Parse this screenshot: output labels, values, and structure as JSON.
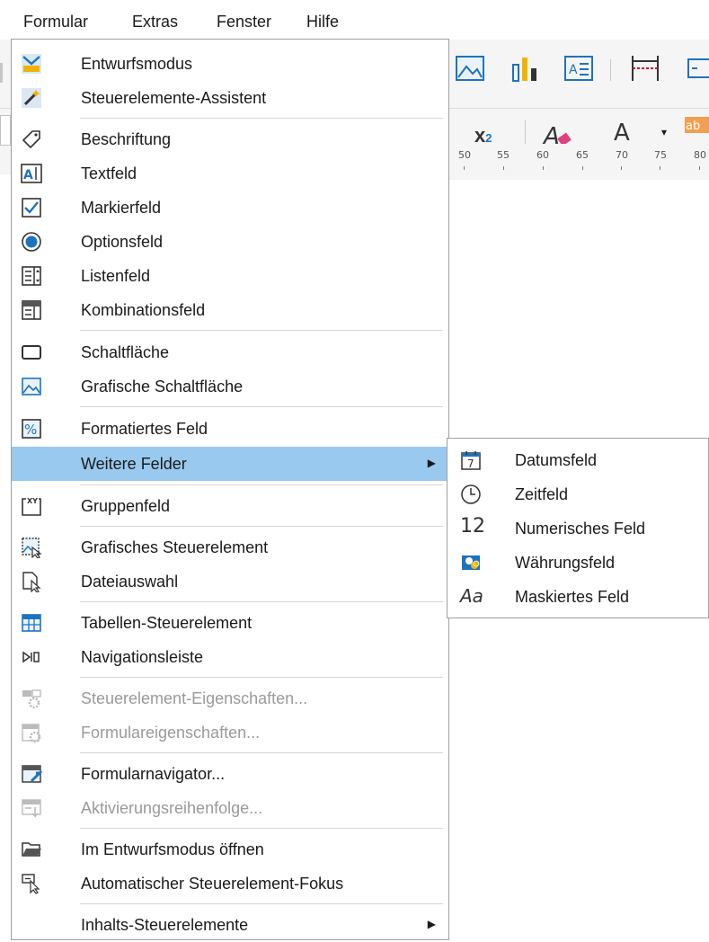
{
  "menubar": {
    "items": [
      "Formular",
      "Extras",
      "Fenster",
      "Hilfe"
    ]
  },
  "ruler": {
    "ticks": [
      "50",
      "55",
      "60",
      "65",
      "70",
      "75",
      "80"
    ]
  },
  "menu": {
    "items": [
      {
        "label": "Entwurfsmodus",
        "icon": "design-mode-icon"
      },
      {
        "label": "Steuerelemente-Assistent",
        "icon": "wizard-icon"
      },
      {
        "label": "Beschriftung",
        "icon": "label-tag-icon"
      },
      {
        "label": "Textfeld",
        "icon": "textbox-icon"
      },
      {
        "label": "Markierfeld",
        "icon": "checkbox-icon"
      },
      {
        "label": "Optionsfeld",
        "icon": "radio-icon"
      },
      {
        "label": "Listenfeld",
        "icon": "listbox-icon"
      },
      {
        "label": "Kombinationsfeld",
        "icon": "combobox-icon"
      },
      {
        "label": "Schaltfläche",
        "icon": "push-button-icon"
      },
      {
        "label": "Grafische Schaltfläche",
        "icon": "image-button-icon"
      },
      {
        "label": "Formatiertes Feld",
        "icon": "formatted-field-icon"
      },
      {
        "label": "Weitere Felder",
        "icon": "",
        "submenu": true,
        "highlighted": true
      },
      {
        "label": "Gruppenfeld",
        "icon": "group-box-icon"
      },
      {
        "label": "Grafisches Steuerelement",
        "icon": "image-control-icon"
      },
      {
        "label": "Dateiauswahl",
        "icon": "file-selection-icon"
      },
      {
        "label": "Tabellen-Steuerelement",
        "icon": "table-control-icon"
      },
      {
        "label": "Navigationsleiste",
        "icon": "navigation-bar-icon"
      },
      {
        "label": "Steuerelement-Eigenschaften...",
        "icon": "control-properties-icon",
        "disabled": true
      },
      {
        "label": "Formulareigenschaften...",
        "icon": "form-properties-icon",
        "disabled": true
      },
      {
        "label": "Formularnavigator...",
        "icon": "form-navigator-icon"
      },
      {
        "label": "Aktivierungsreihenfolge...",
        "icon": "tab-order-icon",
        "disabled": true
      },
      {
        "label": "Im Entwurfsmodus öffnen",
        "icon": "open-folder-icon"
      },
      {
        "label": "Automatischer Steuerelement-Fokus",
        "icon": "auto-focus-icon"
      },
      {
        "label": "Inhalts-Steuerelemente",
        "icon": "",
        "submenu": true
      }
    ]
  },
  "submenu": {
    "items": [
      {
        "label": "Datumsfeld",
        "icon": "calendar-icon"
      },
      {
        "label": "Zeitfeld",
        "icon": "clock-icon"
      },
      {
        "label": "Numerisches Feld",
        "icon": "numeric-12-icon",
        "glyph": "12"
      },
      {
        "label": "Währungsfeld",
        "icon": "currency-icon"
      },
      {
        "label": "Maskiertes Feld",
        "icon": "masked-aa-icon",
        "glyph": "Aa"
      }
    ]
  },
  "toolbar": {
    "subscript": "x",
    "subscript_sub": "2",
    "font_color_letter": "A",
    "highlight_letter": "ab"
  },
  "colors": {
    "highlight": "#99c9ef",
    "accent_blue": "#1e73be",
    "font_color_red": "#c8102e",
    "highlight_yellow": "#f5d800"
  }
}
